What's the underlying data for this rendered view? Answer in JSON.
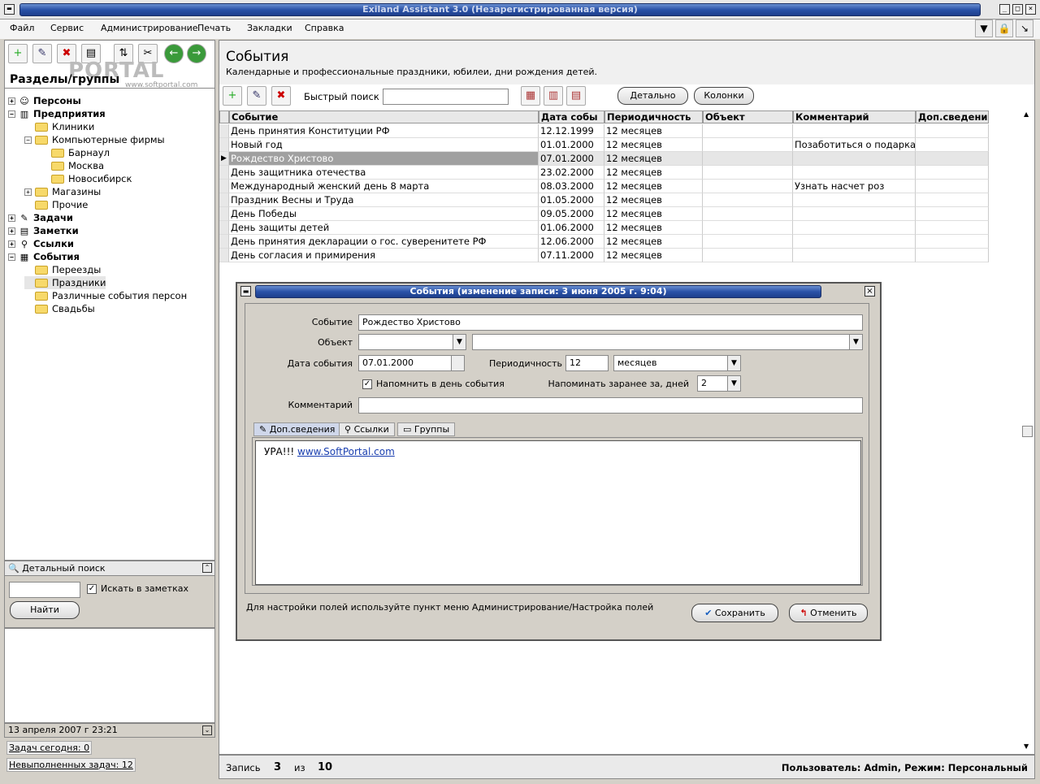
{
  "app": {
    "title": "Exiland Assistant 3.0 (Незарегистрированная версия)"
  },
  "menu": [
    "Файл",
    "Сервис",
    "Администрирование",
    "Печать",
    "Закладки",
    "Справка"
  ],
  "watermark": {
    "brand": "PORTAL",
    "site": "www.softportal.com"
  },
  "sections": {
    "title": "Разделы/группы"
  },
  "tree": [
    {
      "label": "Персоны",
      "level": 0,
      "bold": true,
      "exp": "+",
      "icon": "person-icon"
    },
    {
      "label": "Предприятия",
      "level": 0,
      "bold": true,
      "exp": "−",
      "icon": "building-icon"
    },
    {
      "label": "Клиники",
      "level": 1,
      "bold": false,
      "exp": "",
      "icon": "folder-icon"
    },
    {
      "label": "Компьютерные фирмы",
      "level": 1,
      "bold": false,
      "exp": "−",
      "icon": "folder-icon"
    },
    {
      "label": "Барнаул",
      "level": 2,
      "bold": false,
      "exp": "",
      "icon": "folder-icon"
    },
    {
      "label": "Москва",
      "level": 2,
      "bold": false,
      "exp": "",
      "icon": "folder-icon"
    },
    {
      "label": "Новосибирск",
      "level": 2,
      "bold": false,
      "exp": "",
      "icon": "folder-icon"
    },
    {
      "label": "Магазины",
      "level": 1,
      "bold": false,
      "exp": "+",
      "icon": "folder-icon"
    },
    {
      "label": "Прочие",
      "level": 1,
      "bold": false,
      "exp": "",
      "icon": "folder-icon"
    },
    {
      "label": "Задачи",
      "level": 0,
      "bold": true,
      "exp": "+",
      "icon": "task-icon"
    },
    {
      "label": "Заметки",
      "level": 0,
      "bold": true,
      "exp": "+",
      "icon": "note-icon"
    },
    {
      "label": "Ссылки",
      "level": 0,
      "bold": true,
      "exp": "+",
      "icon": "link-icon"
    },
    {
      "label": "События",
      "level": 0,
      "bold": true,
      "exp": "−",
      "icon": "calendar-icon"
    },
    {
      "label": "Переезды",
      "level": 1,
      "bold": false,
      "exp": "",
      "icon": "folder-icon"
    },
    {
      "label": "Праздники",
      "level": 1,
      "bold": false,
      "exp": "",
      "icon": "folder-icon",
      "selected": true
    },
    {
      "label": "Различные события персон",
      "level": 1,
      "bold": false,
      "exp": "",
      "icon": "folder-icon"
    },
    {
      "label": "Свадьбы",
      "level": 1,
      "bold": false,
      "exp": "",
      "icon": "folder-icon"
    }
  ],
  "detail_search": {
    "title": "Детальный поиск",
    "checkbox": "Искать в заметках",
    "button": "Найти",
    "query": ""
  },
  "left_status": {
    "date": "13 апреля 2007 г  23:21",
    "tasks_today": "Задач сегодня: 0",
    "tasks_open": "Невыполненных задач: 12"
  },
  "main": {
    "title": "События",
    "subtitle": "Календарные и профессиональные праздники, юбилеи, дни рождения детей.",
    "quick_search": "Быстрый поиск",
    "quick_search_value": "",
    "btn_detail": "Детально",
    "btn_columns": "Колонки",
    "columns": [
      "Событие",
      "Дата собы",
      "Периодичность",
      "Объект",
      "Комментарий",
      "Доп.сведения"
    ],
    "rows": [
      [
        "День принятия Конституции РФ",
        "12.12.1999",
        "12 месяцев",
        "",
        "",
        ""
      ],
      [
        "Новый год",
        "01.01.2000",
        "12 месяцев",
        "",
        "Позаботиться о подарках",
        ""
      ],
      [
        "Рождество Христово",
        "07.01.2000",
        "12 месяцев",
        "",
        "",
        ""
      ],
      [
        "День защитника отечества",
        "23.02.2000",
        "12 месяцев",
        "",
        "",
        ""
      ],
      [
        "Международный женский день 8 марта",
        "08.03.2000",
        "12 месяцев",
        "",
        "Узнать насчет роз",
        ""
      ],
      [
        "Праздник Весны и Труда",
        "01.05.2000",
        "12 месяцев",
        "",
        "",
        ""
      ],
      [
        "День Победы",
        "09.05.2000",
        "12 месяцев",
        "",
        "",
        ""
      ],
      [
        "День защиты детей",
        "01.06.2000",
        "12 месяцев",
        "",
        "",
        ""
      ],
      [
        "День принятия декларации о гос. суверенитете РФ",
        "12.06.2000",
        "12 месяцев",
        "",
        "",
        ""
      ],
      [
        "День согласия и примирения",
        "07.11.2000",
        "12 месяцев",
        "",
        "",
        ""
      ]
    ],
    "selected_row": 2
  },
  "dialog": {
    "title": "События  (изменение записи: 3 июня 2005 г. 9:04)",
    "lbl_event": "Событие",
    "event": "Рождество Христово",
    "lbl_object": "Объект",
    "object": "",
    "object2": "",
    "lbl_date": "Дата события",
    "date": "07.01.2000",
    "lbl_period": "Периодичность",
    "period": "12",
    "period_unit": "месяцев",
    "remind_check": "Напомнить в день события",
    "lbl_remind_ahead": "Напоминать заранее за, дней",
    "remind_ahead": "2",
    "lbl_comment": "Комментарий",
    "comment": "",
    "tabs": [
      "Доп.сведения",
      "Ссылки",
      "Группы"
    ],
    "memo_text": "УРА!!! ",
    "memo_link": "www.SoftPortal.com",
    "hint": "Для настройки полей используйте пункт меню Администрирование/Настройка полей",
    "save": "Сохранить",
    "cancel": "Отменить"
  },
  "status": {
    "record_label": "Запись",
    "record": "3",
    "of": "из",
    "total": "10",
    "user": "Пользователь: Admin,   Режим: Персональный"
  }
}
